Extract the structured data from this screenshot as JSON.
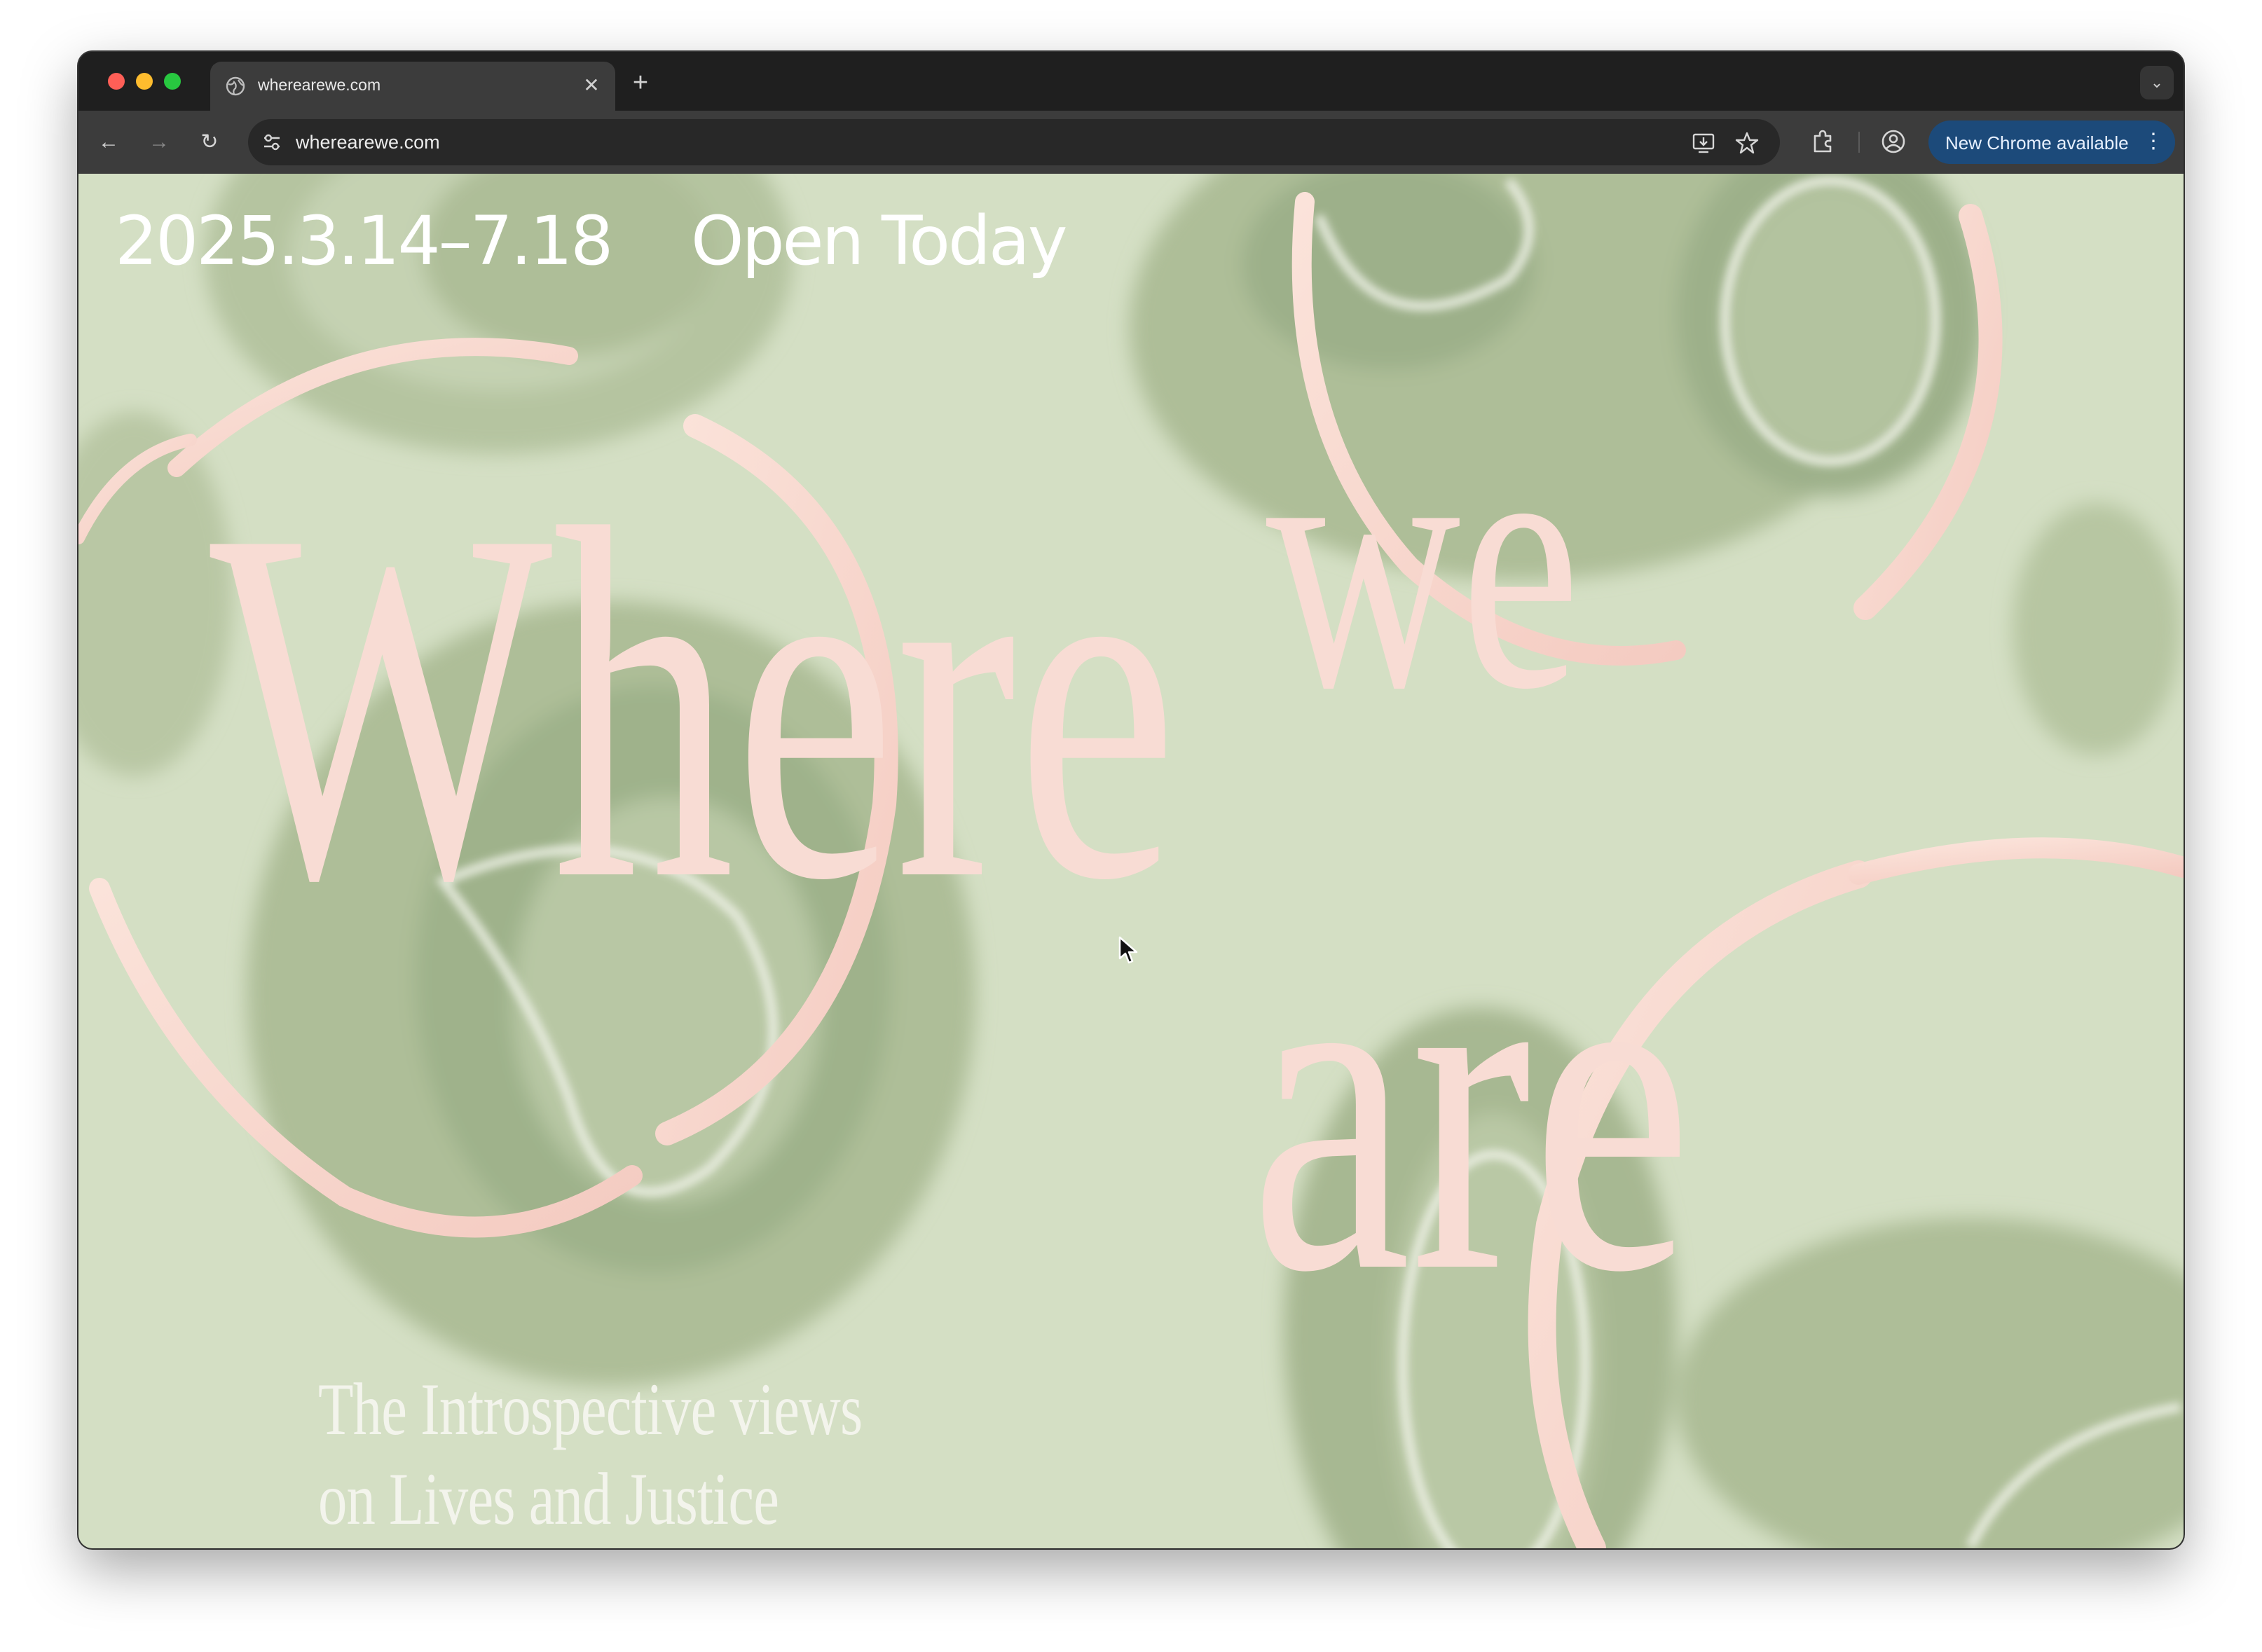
{
  "browser": {
    "tab": {
      "title": "wherearewe.com"
    },
    "new_tab_label": "+",
    "address_bar": {
      "url": "wherearewe.com"
    },
    "update_button": {
      "label": "New Chrome available"
    }
  },
  "page": {
    "date_range": "2025.3.14–7.18",
    "status": "Open Today",
    "title_words": [
      "Where",
      "we",
      "are"
    ],
    "subtitle_lines": [
      "The Introspective views",
      "on Lives and Justice"
    ]
  },
  "colors": {
    "background": "#d4dfc4",
    "title_pink": "#f8dcd4",
    "blob_green": "#a7b892",
    "header_text": "#ffffff"
  }
}
